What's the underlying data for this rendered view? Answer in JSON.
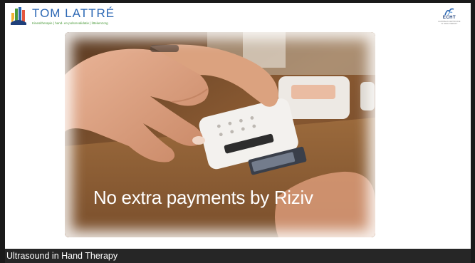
{
  "header": {
    "brand_name": "TOM LATTRÉ",
    "brand_tagline": "Kinesitherapie | hand- en polsrevalidatie | littekenzorg",
    "partner_name": "ECHT",
    "partner_sub": "EUROPEAN CERTIFICATE IN HAND THERAPY"
  },
  "slide": {
    "caption": "No extra payments by Riziv"
  },
  "footer": {
    "title": "Ultrasound in Hand Therapy"
  },
  "colors": {
    "brand_blue": "#2b67b4",
    "brand_green": "#4a9a3a",
    "footer_bg": "#262626"
  },
  "icons": {
    "brand_logo": "hand-logo-icon",
    "partner_logo": "echt-logo-icon",
    "photo": "card-payment-photo"
  }
}
